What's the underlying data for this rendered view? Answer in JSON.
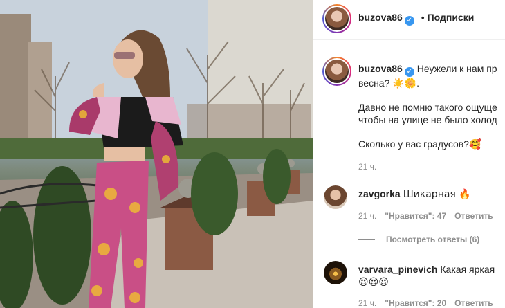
{
  "post": {
    "username": "buzova86",
    "follow_separator": "•",
    "follow_label": "Подписки",
    "caption_lines": [
      "Неужели к нам пр",
      "весна? ☀️🌼.",
      "Давно не помню такого ощуще",
      "чтобы на улице не было холод",
      "Сколько у вас градусов?🥰"
    ],
    "caption_time": "21 ч."
  },
  "comments": [
    {
      "username": "zavgorka",
      "text": "Шикарная 🔥",
      "time": "21 ч.",
      "likes": "\"Нравится\": 47",
      "reply": "Ответить"
    },
    {
      "username": "varvara_pinevich",
      "text": "Какая яркая",
      "text2": "😍😍😍",
      "time": "21 ч.",
      "likes": "\"Нравится\": 20",
      "reply": "Ответить"
    }
  ],
  "view_replies": "Посмотреть ответы (6)",
  "icons": {
    "verified": "verified-badge-icon"
  }
}
